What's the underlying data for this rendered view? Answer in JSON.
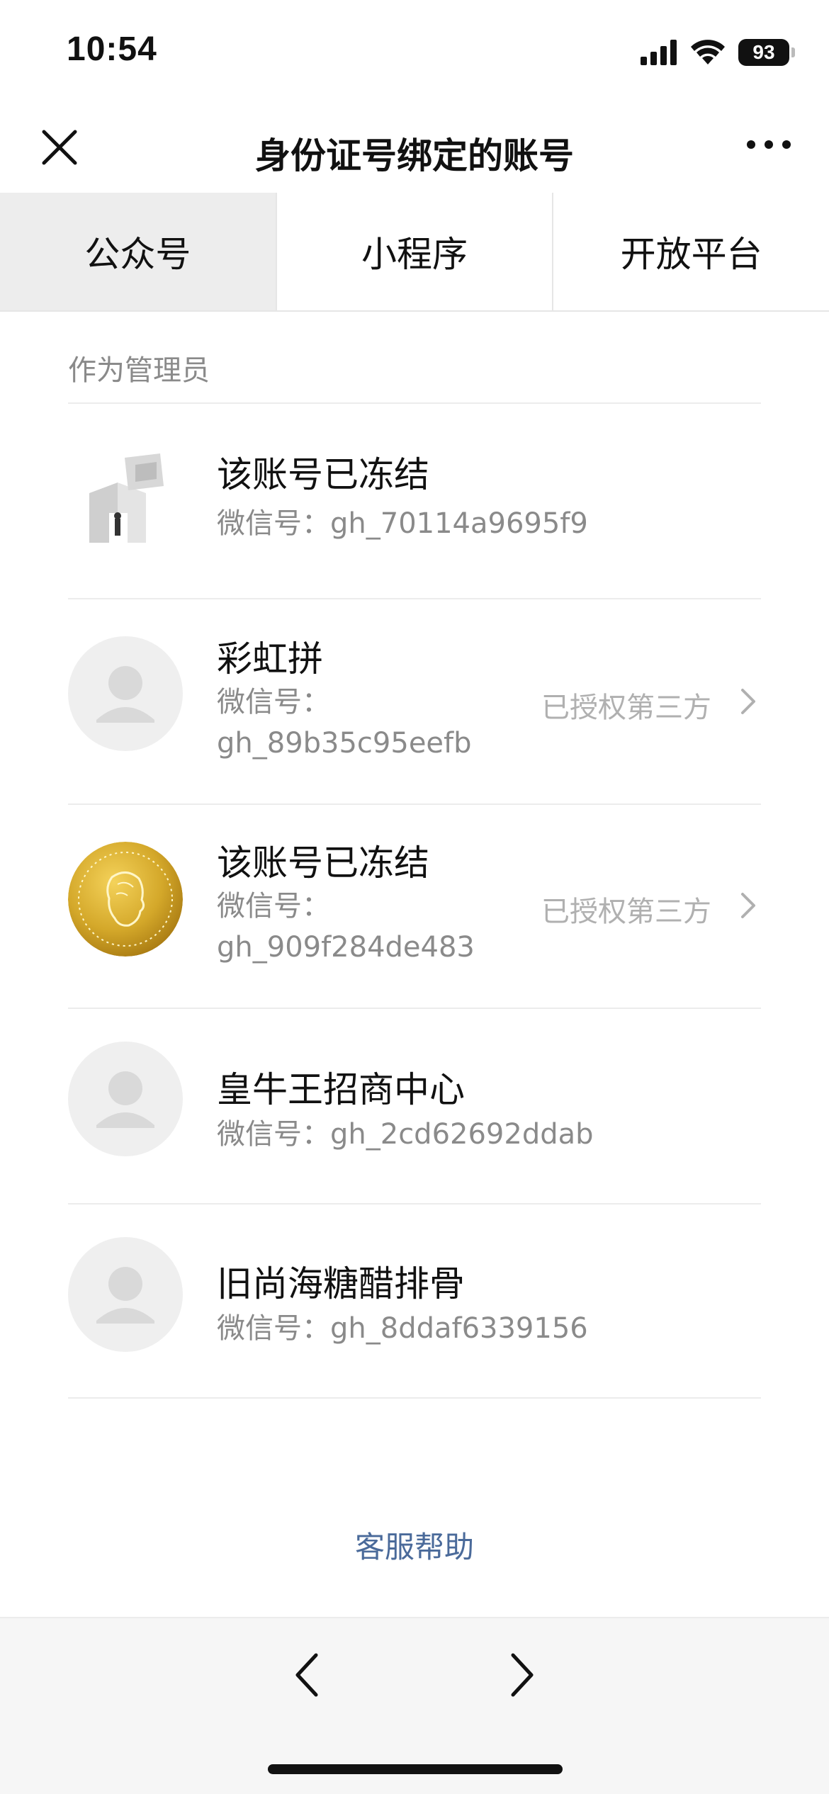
{
  "status_bar": {
    "time": "10:54",
    "battery": "93"
  },
  "nav": {
    "title": "身份证号绑定的账号"
  },
  "tabs": [
    {
      "label": "公众号",
      "active": true
    },
    {
      "label": "小程序",
      "active": false
    },
    {
      "label": "开放平台",
      "active": false
    }
  ],
  "section": {
    "label": "作为管理员"
  },
  "accounts": [
    {
      "name": "该账号已冻结",
      "id_label": "微信号：",
      "id_value": "gh_70114a9695f9",
      "badge": "",
      "avatar": "3d-sculpture"
    },
    {
      "name": "彩虹拼",
      "id_label": "微信号：",
      "id_value": "gh_89b35c95eefb",
      "badge": "已授权第三方",
      "avatar": "placeholder"
    },
    {
      "name": "该账号已冻结",
      "id_label": "微信号：",
      "id_value": "gh_909f284de483",
      "badge": "已授权第三方",
      "avatar": "gold-coin"
    },
    {
      "name": "皇牛王招商中心",
      "id_label": "微信号：",
      "id_value": "gh_2cd62692ddab",
      "badge": "",
      "avatar": "placeholder"
    },
    {
      "name": "旧尚海糖醋排骨",
      "id_label": "微信号：",
      "id_value": "gh_8ddaf6339156",
      "badge": "",
      "avatar": "placeholder"
    }
  ],
  "help": {
    "label": "客服帮助"
  },
  "colors": {
    "link": "#4a6a9a",
    "muted": "#8a8a8a",
    "active_tab_bg": "#ededed",
    "gold": "#d4a82a"
  }
}
